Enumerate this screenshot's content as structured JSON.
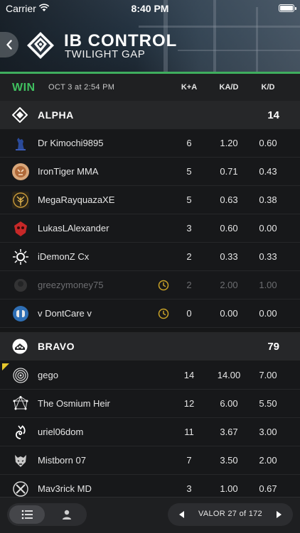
{
  "status_bar": {
    "carrier": "Carrier",
    "time": "8:40 PM"
  },
  "header": {
    "mode_title": "IB CONTROL",
    "map_name": "TWILIGHT GAP",
    "accent": "#3fae5e"
  },
  "result": {
    "outcome": "WIN",
    "date": "OCT 3 at 2:54 PM",
    "columns": [
      "K+A",
      "KA/D",
      "K/D"
    ],
    "win_color": "#3fbf5f"
  },
  "teams": [
    {
      "name": "ALPHA",
      "score": "14",
      "players": [
        {
          "name": "Dr Kimochi9895",
          "ka": "6",
          "kad": "1.20",
          "kd": "0.60",
          "emblem": "blue-cat-emblem"
        },
        {
          "name": "IronTiger MMA",
          "ka": "5",
          "kad": "0.71",
          "kd": "0.43",
          "emblem": "tiger-emblem"
        },
        {
          "name": "MegaRayquazaXE",
          "ka": "5",
          "kad": "0.63",
          "kd": "0.38",
          "emblem": "golden-tree-emblem"
        },
        {
          "name": "LukasLAlexander",
          "ka": "3",
          "kad": "0.60",
          "kd": "0.00",
          "emblem": "red-skull-emblem"
        },
        {
          "name": "iDemonZ Cx",
          "ka": "2",
          "kad": "0.33",
          "kd": "0.33",
          "emblem": "eclipse-emblem"
        },
        {
          "name": "greezymoney75",
          "ka": "2",
          "kad": "2.00",
          "kd": "1.00",
          "emblem": "dark-emblem",
          "left_early": true
        },
        {
          "name": "v DontCare v",
          "ka": "0",
          "kad": "0.00",
          "kd": "0.00",
          "emblem": "blue-badge-emblem",
          "left_early": true
        }
      ]
    },
    {
      "name": "BRAVO",
      "score": "79",
      "players": [
        {
          "name": "gego",
          "ka": "14",
          "kad": "14.00",
          "kd": "7.00",
          "emblem": "spiral-emblem"
        },
        {
          "name": "The Osmium Heir",
          "ka": "12",
          "kad": "6.00",
          "kd": "5.50",
          "emblem": "constellation-emblem"
        },
        {
          "name": "uriel06dom",
          "ka": "11",
          "kad": "3.67",
          "kd": "3.00",
          "emblem": "swirl-emblem"
        },
        {
          "name": "Mistborn 07",
          "ka": "7",
          "kad": "3.50",
          "kd": "2.00",
          "emblem": "wolf-emblem"
        },
        {
          "name": "Mav3rick MD",
          "ka": "3",
          "kad": "1.00",
          "kd": "0.67",
          "emblem": "crossed-emblem"
        }
      ]
    }
  ],
  "bottom_bar": {
    "pager": "VALOR 27 of 172",
    "tabs": [
      "list-icon",
      "person-icon"
    ]
  }
}
